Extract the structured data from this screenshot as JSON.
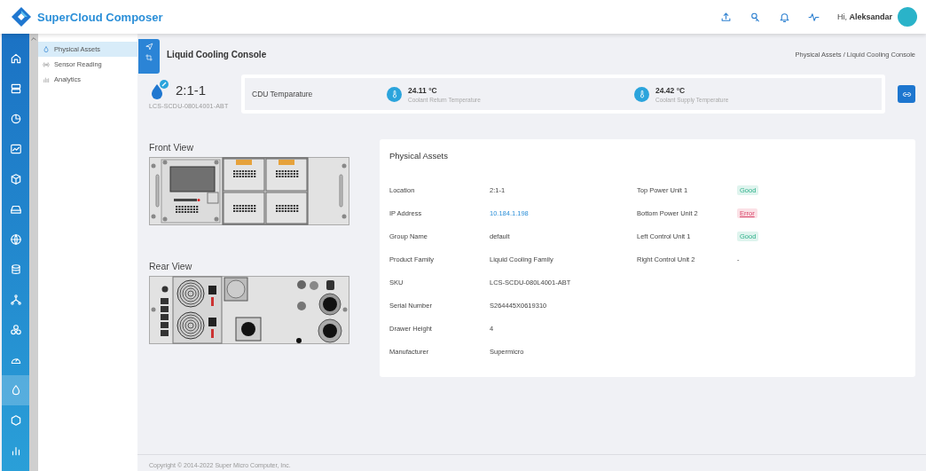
{
  "app": {
    "title": "SuperCloud Composer"
  },
  "header": {
    "greeting": "Hi,",
    "user": "Aleksandar"
  },
  "rail": [
    {
      "selected": false
    },
    {
      "selected": false
    },
    {
      "selected": false
    },
    {
      "selected": false
    },
    {
      "selected": false
    },
    {
      "selected": false
    },
    {
      "selected": false
    },
    {
      "selected": false
    },
    {
      "selected": false
    },
    {
      "selected": false
    },
    {
      "selected": false
    },
    {
      "selected": true
    },
    {
      "selected": false
    },
    {
      "selected": false
    }
  ],
  "submenu": [
    {
      "label": "Physical Assets",
      "selected": true
    },
    {
      "label": "Sensor Reading",
      "selected": false
    },
    {
      "label": "Analytics",
      "selected": false
    }
  ],
  "page": {
    "title": "Liquid Cooling Console",
    "breadcrumb": "Physical Assets / Liquid Cooling Console"
  },
  "device": {
    "name": "2:1-1",
    "sku": "LCS-SCDU-080L4001-ABT"
  },
  "temperature": {
    "label": "CDU Temparature",
    "readings": [
      {
        "value": "24.11 °C",
        "label": "Coolant Return Temperature"
      },
      {
        "value": "24.42 °C",
        "label": "Coolant Supply Temperature"
      }
    ]
  },
  "views": [
    {
      "title": "Front View",
      "kind": "front"
    },
    {
      "title": "Rear View",
      "kind": "rear"
    }
  ],
  "assets": {
    "title": "Physical Assets",
    "details": [
      {
        "label": "Location",
        "value": "2:1-1",
        "kind": "text"
      },
      {
        "label": "IP Address",
        "value": "10.184.1.198",
        "kind": "link"
      },
      {
        "label": "Group Name",
        "value": "default",
        "kind": "text"
      },
      {
        "label": "Product Family",
        "value": "Liquid Cooling Family",
        "kind": "text"
      },
      {
        "label": "SKU",
        "value": "LCS-SCDU-080L4001-ABT",
        "kind": "text"
      },
      {
        "label": "Serial Number",
        "value": "S264445X0619310",
        "kind": "text"
      },
      {
        "label": "Drawer Height",
        "value": "4",
        "kind": "text"
      },
      {
        "label": "Manufacturer",
        "value": "Supermicro",
        "kind": "text"
      }
    ],
    "units": [
      {
        "label": "Top Power Unit 1",
        "value": "Good",
        "kind": "good"
      },
      {
        "label": "Bottom Power Unit 2",
        "value": "Error",
        "kind": "error"
      },
      {
        "label": "Left Control Unit 1",
        "value": "Good",
        "kind": "good"
      },
      {
        "label": "Right Control Unit 2",
        "value": "-",
        "kind": "text"
      }
    ]
  },
  "footer": {
    "text": "Copyright © 2014-2022 Super Micro Computer, Inc."
  }
}
